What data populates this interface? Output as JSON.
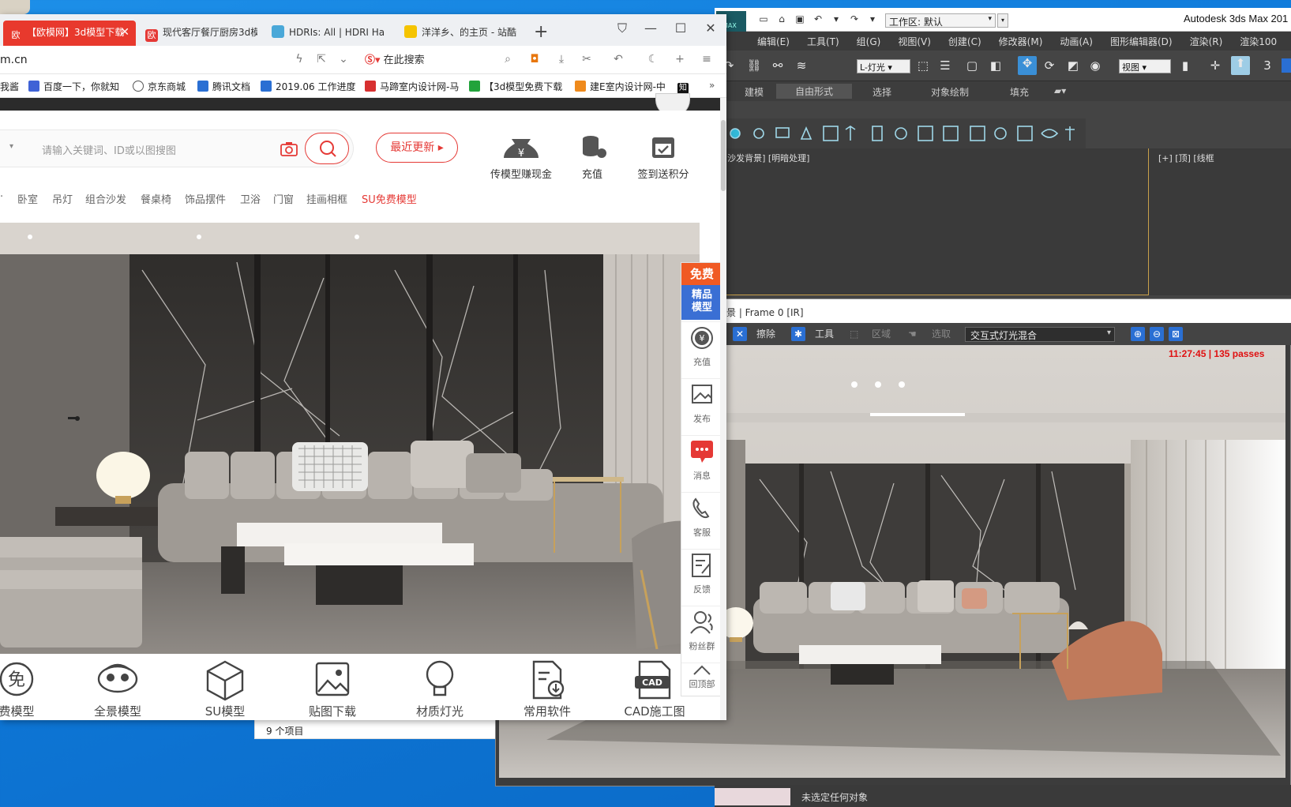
{
  "max": {
    "workspace_label": "工作区: 默认",
    "app_title": "Autodesk 3ds Max 201",
    "logo_text": "MAX",
    "menu": [
      "编辑(E)",
      "工具(T)",
      "组(G)",
      "视图(V)",
      "创建(C)",
      "修改器(M)",
      "动画(A)",
      "图形编辑器(D)",
      "渲染(R)",
      "渲染100"
    ],
    "layer_select": "L-灯光",
    "view_select": "视图",
    "num_3": "3",
    "ribbon": [
      "建模",
      "自由形式",
      "选择",
      "对象绘制",
      "填充"
    ],
    "viewport_label_left": "] [沙发背景] [明暗处理]",
    "viewport_label_right": "[+] [顶] [线框",
    "statusbar_text": "未选定任何对象"
  },
  "render_frame": {
    "title": "景 | Frame 0 [IR]",
    "erase_label": "擦除",
    "tools_label": "工具",
    "region_label": "区域",
    "pick_label": "选取",
    "mix_label": "交互式灯光混合",
    "status": "11:27:45  |  135 passes"
  },
  "explorer": {
    "items_count": "9 个项目"
  },
  "browser": {
    "tabs": [
      {
        "label": "【欧模网】3d模型下载",
        "fav_color": "#ffffff",
        "fav_text": "欧"
      },
      {
        "label": "现代客厅餐厅厨房3d模",
        "fav_color": "#e53935",
        "fav_text": "欧"
      },
      {
        "label": "HDRIs: All | HDRI Ha",
        "fav_color": "#4aa8d8",
        "fav_text": ""
      },
      {
        "label": "洋洋乡、的主页 - 站酷",
        "fav_color": "#f5c400",
        "fav_text": ""
      }
    ],
    "address": "m.cn",
    "search_placeholder": "在此搜索",
    "bookmarks": [
      "我酱",
      "百度一下，你就知",
      "京东商城",
      "腾讯文档",
      "2019.06 工作进度",
      "马蹄室内设计网-马",
      "【3d模型免费下载",
      "建E室内设计网-中",
      "知"
    ],
    "site": {
      "search_placeholder": "请输入关键词、ID或以图搜图",
      "recent_button": "最近更新",
      "quick_actions": [
        "传模型赚现金",
        "充值",
        "签到送积分"
      ],
      "categories": [
        "卧室",
        "吊灯",
        "组合沙发",
        "餐桌椅",
        "饰品摆件",
        "卫浴",
        "门窗",
        "挂画相框",
        "SU免费模型"
      ],
      "bottom_nav": [
        "费模型",
        "全景模型",
        "SU模型",
        "贴图下载",
        "材质灯光",
        "常用软件",
        "CAD施工图"
      ],
      "bottom_icon_text": {
        "free": "免",
        "cad": "CAD"
      },
      "side_free_top": "免费",
      "side_free_bottom": "精品\n模型",
      "side_items": [
        "充值",
        "发布",
        "消息",
        "客服",
        "反馈",
        "粉丝群",
        "回顶部"
      ],
      "accent": "#e53935"
    }
  }
}
